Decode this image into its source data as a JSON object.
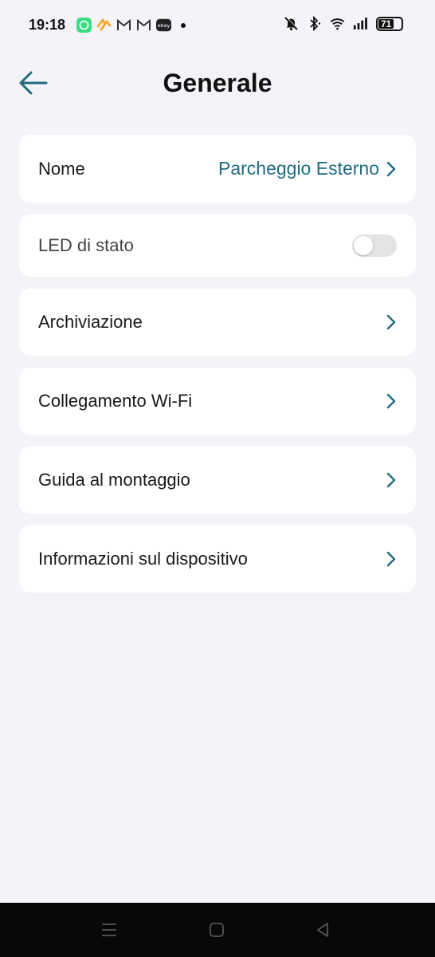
{
  "status_bar": {
    "time": "19:18",
    "battery": "71",
    "battery_level": 0.71,
    "notification_icons": [
      "whatsapp-icon",
      "strava-icon",
      "gmail-icon",
      "gmail-icon",
      "ebay-icon"
    ],
    "status_icons": [
      "mute-icon",
      "bluetooth-icon",
      "wifi-icon",
      "signal-icon",
      "battery-icon"
    ],
    "ebay_text": "ebay"
  },
  "header": {
    "title": "Generale"
  },
  "colors": {
    "accent": "#1f6b80",
    "background": "#f4f4f8",
    "card": "#ffffff"
  },
  "items": [
    {
      "label": "Nome",
      "value": "Parcheggio Esterno",
      "type": "link"
    },
    {
      "label": "LED di stato",
      "type": "toggle",
      "checked": false
    },
    {
      "label": "Archiviazione",
      "type": "link"
    },
    {
      "label": "Collegamento Wi-Fi",
      "type": "link"
    },
    {
      "label": "Guida al montaggio",
      "type": "link"
    },
    {
      "label": "Informazioni sul dispositivo",
      "type": "link"
    }
  ],
  "nav": {
    "buttons": [
      "menu-icon",
      "home-icon",
      "back-icon"
    ]
  }
}
